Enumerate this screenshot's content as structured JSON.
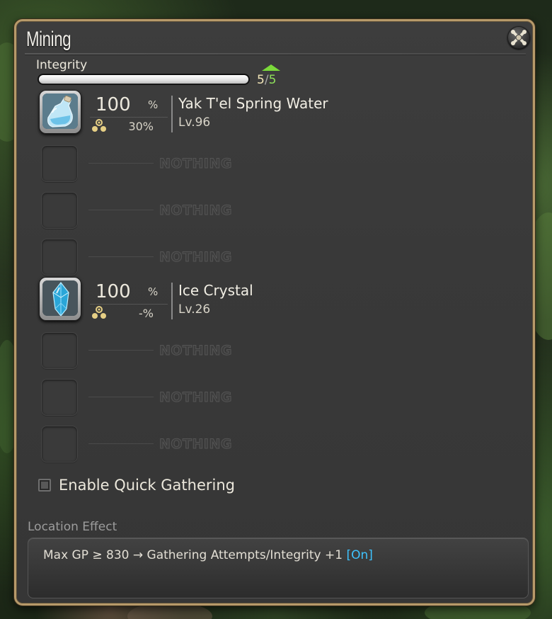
{
  "window": {
    "title": "Mining",
    "close_icon": "close-ornament-icon"
  },
  "integrity": {
    "label": "Integrity",
    "current": "5",
    "separator": "/",
    "max": "5",
    "fill_fraction": 1.0,
    "trend_icon": "up-arrow-icon"
  },
  "slots": [
    {
      "type": "item",
      "name": "Yak T'el Spring Water",
      "level": "Lv.96",
      "chance": "100",
      "chance_unit": "%",
      "hq_chance": "30%",
      "icon": "bottle-icon"
    },
    {
      "type": "empty",
      "text": "NOTHING"
    },
    {
      "type": "empty",
      "text": "NOTHING"
    },
    {
      "type": "empty",
      "text": "NOTHING"
    },
    {
      "type": "item",
      "name": "Ice Crystal",
      "level": "Lv.26",
      "chance": "100",
      "chance_unit": "%",
      "hq_chance": "-%",
      "icon": "ice-crystal-icon"
    },
    {
      "type": "empty",
      "text": "NOTHING"
    },
    {
      "type": "empty",
      "text": "NOTHING"
    },
    {
      "type": "empty",
      "text": "NOTHING"
    }
  ],
  "quick_gathering": {
    "label": "Enable Quick Gathering",
    "checked": false
  },
  "location_effect": {
    "label": "Location Effect",
    "text": "Max GP ≥ 830 → Gathering Attempts/Integrity +1",
    "status": "[On]"
  },
  "colors": {
    "frame_gold": "#b79a6a",
    "panel": "#3a3a3a",
    "integrity_max": "#8ee05a",
    "status_on": "#3ec3ff"
  }
}
